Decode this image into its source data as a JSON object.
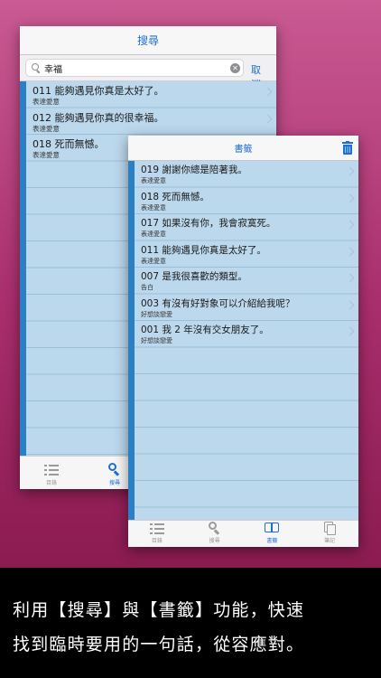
{
  "colors": {
    "accent": "#1e6fd0",
    "list_background": "#bcd8ec",
    "list_stripe": "#2a7fc5",
    "background_gradient_top": "#c95a92",
    "background_gradient_bottom": "#7f1445"
  },
  "search_screen": {
    "title": "搜尋",
    "search": {
      "value": "幸福",
      "placeholder": ""
    },
    "cancel_label": "取消",
    "results": [
      {
        "title": "011 能夠遇見你真是太好了。",
        "category": "表達愛意"
      },
      {
        "title": "012 能夠遇見你真的很幸福。",
        "category": "表達愛意"
      },
      {
        "title": "018 死而無憾。",
        "category": "表達愛意"
      }
    ],
    "tabs": [
      {
        "label": "目錄",
        "icon": "list-icon"
      },
      {
        "label": "搜尋",
        "icon": "search-icon"
      }
    ]
  },
  "bookmark_screen": {
    "title": "書籤",
    "items": [
      {
        "title": "019 謝謝你總是陪著我。",
        "category": "表達愛意"
      },
      {
        "title": "018 死而無憾。",
        "category": "表達愛意"
      },
      {
        "title": "017 如果沒有你，我會寂寞死。",
        "category": "表達愛意"
      },
      {
        "title": "011 能夠遇見你真是太好了。",
        "category": "表達愛意"
      },
      {
        "title": "007 是我很喜歡的類型。",
        "category": "告白"
      },
      {
        "title": "003 有沒有好對象可以介紹給我呢？",
        "category": "好想談戀愛"
      },
      {
        "title": "001 我 2 年沒有交女朋友了。",
        "category": "好想談戀愛"
      }
    ],
    "tabs": [
      {
        "label": "目錄",
        "icon": "list-icon"
      },
      {
        "label": "搜尋",
        "icon": "search-icon"
      },
      {
        "label": "書籤",
        "icon": "book-icon"
      },
      {
        "label": "筆記",
        "icon": "note-icon"
      }
    ]
  },
  "caption": {
    "line1": "利用【搜尋】與【書籤】功能，快速",
    "line2": "找到臨時要用的一句話，從容應對。"
  }
}
